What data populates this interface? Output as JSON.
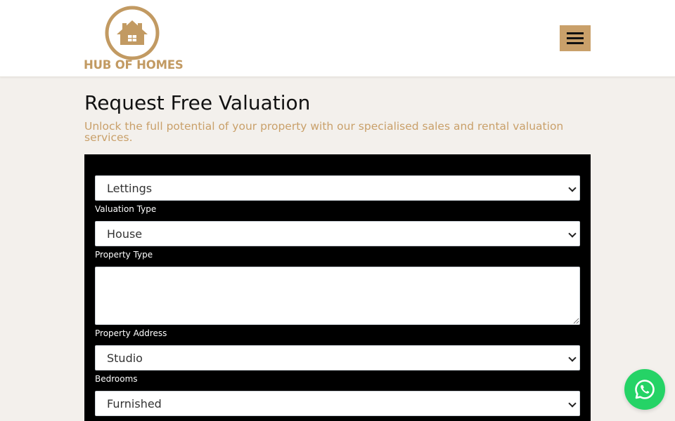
{
  "brand": {
    "logo_text": "HUB OF HOMES",
    "accent": "#c9a06a"
  },
  "header": {
    "menu_icon": "hamburger-icon"
  },
  "page": {
    "title": "Request Free Valuation",
    "subtitle": "Unlock the full potential of your property with our specialised sales and rental valuation services."
  },
  "form": {
    "valuation_type": {
      "value": "Lettings",
      "label": "Valuation Type"
    },
    "property_type": {
      "value": "House",
      "label": "Property Type"
    },
    "property_address": {
      "value": "",
      "label": "Property Address"
    },
    "bedrooms": {
      "value": "Studio",
      "label": "Bedrooms"
    },
    "furnishing": {
      "value": "Furnished"
    }
  },
  "chat": {
    "icon": "whatsapp-icon",
    "color": "#25d366"
  }
}
